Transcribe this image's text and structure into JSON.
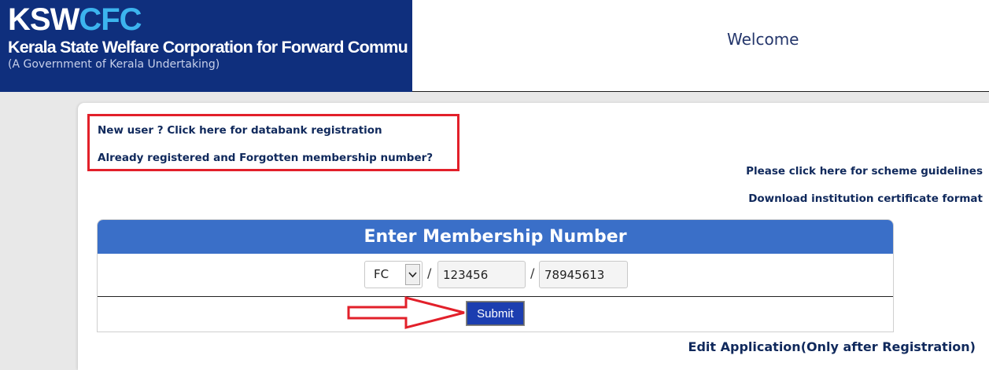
{
  "header": {
    "logo_ksw": "KSW",
    "logo_cfc": "CFC",
    "org_name": "Kerala State Welfare Corporation for Forward Commu",
    "org_sub": "(A Government of Kerala Undertaking)",
    "welcome": "Welcome"
  },
  "links": {
    "new_user": "New user ? Click here for databank registration",
    "forgot": "Already registered and Forgotten membership number?",
    "guidelines": "Please click here for scheme guidelines",
    "certificate": "Download institution certificate format",
    "edit": "Edit Application(Only after Registration)"
  },
  "form": {
    "title": "Enter Membership Number",
    "prefix_selected": "FC",
    "separator": "/",
    "part2_value": "123456",
    "part3_value": "78945613",
    "submit_label": "Submit"
  },
  "colors": {
    "brand_navy": "#0f2f7d",
    "accent_cyan": "#3cb4ee",
    "form_header_blue": "#3a6fc8",
    "annotation_red": "#e2202a",
    "link_navy": "#10295c",
    "submit_blue": "#1c3eb0"
  }
}
